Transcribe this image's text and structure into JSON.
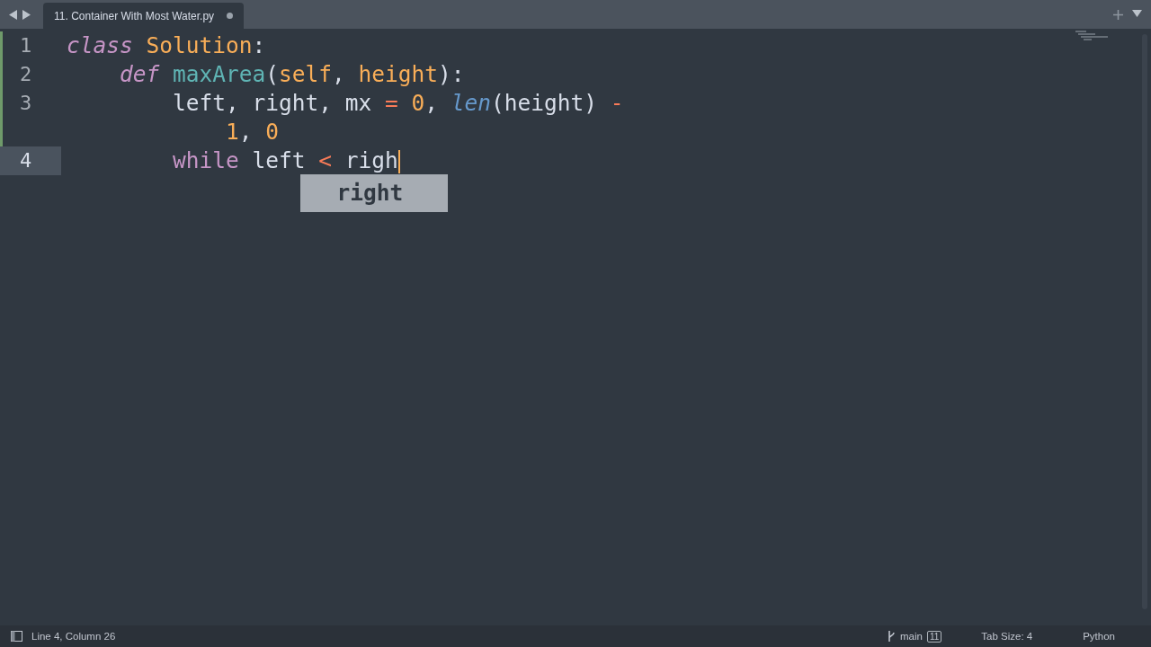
{
  "tabs": [
    {
      "label": "11. Container With Most Water.py",
      "selected": true,
      "modified": true
    }
  ],
  "editor": {
    "lines": [
      {
        "number": "1",
        "modified": true,
        "current": false,
        "rows": [
          {
            "tokens": [
              {
                "kind": "storage",
                "text": "class"
              },
              {
                "kind": "classname",
                "text": " Solution"
              },
              {
                "kind": "plain",
                "text": ":"
              }
            ]
          }
        ]
      },
      {
        "number": "2",
        "modified": true,
        "current": false,
        "rows": [
          {
            "tokens": [
              {
                "kind": "storage",
                "text": "    def"
              },
              {
                "kind": "function",
                "text": " maxArea"
              },
              {
                "kind": "plain",
                "text": "("
              },
              {
                "kind": "param",
                "text": "self"
              },
              {
                "kind": "plain",
                "text": ", "
              },
              {
                "kind": "param",
                "text": "height"
              },
              {
                "kind": "plain",
                "text": "):"
              }
            ]
          }
        ]
      },
      {
        "number": "3",
        "modified": true,
        "current": false,
        "rows": [
          {
            "tokens": [
              {
                "kind": "plain",
                "text": "        left, right, mx "
              },
              {
                "kind": "operator",
                "text": "="
              },
              {
                "kind": "number",
                "text": " 0"
              },
              {
                "kind": "plain",
                "text": ", "
              },
              {
                "kind": "builtin",
                "text": "len"
              },
              {
                "kind": "plain",
                "text": "(height) "
              },
              {
                "kind": "operator",
                "text": "-"
              }
            ]
          },
          {
            "tokens": [
              {
                "kind": "number",
                "text": "            1"
              },
              {
                "kind": "plain",
                "text": ", "
              },
              {
                "kind": "number",
                "text": "0"
              }
            ]
          }
        ]
      },
      {
        "number": "4",
        "modified": false,
        "current": true,
        "rows": [
          {
            "tokens": [
              {
                "kind": "keyword",
                "text": "        while"
              },
              {
                "kind": "plain",
                "text": " left "
              },
              {
                "kind": "operator",
                "text": "<"
              },
              {
                "kind": "plain",
                "text": " righ"
              }
            ]
          }
        ]
      }
    ],
    "autocomplete": {
      "items": [
        {
          "label": "right",
          "selected": true
        }
      ]
    }
  },
  "status_bar": {
    "position": "Line 4, Column 26",
    "branch": "main",
    "changes": "11",
    "tab_size": "Tab Size: 4",
    "syntax": "Python"
  }
}
